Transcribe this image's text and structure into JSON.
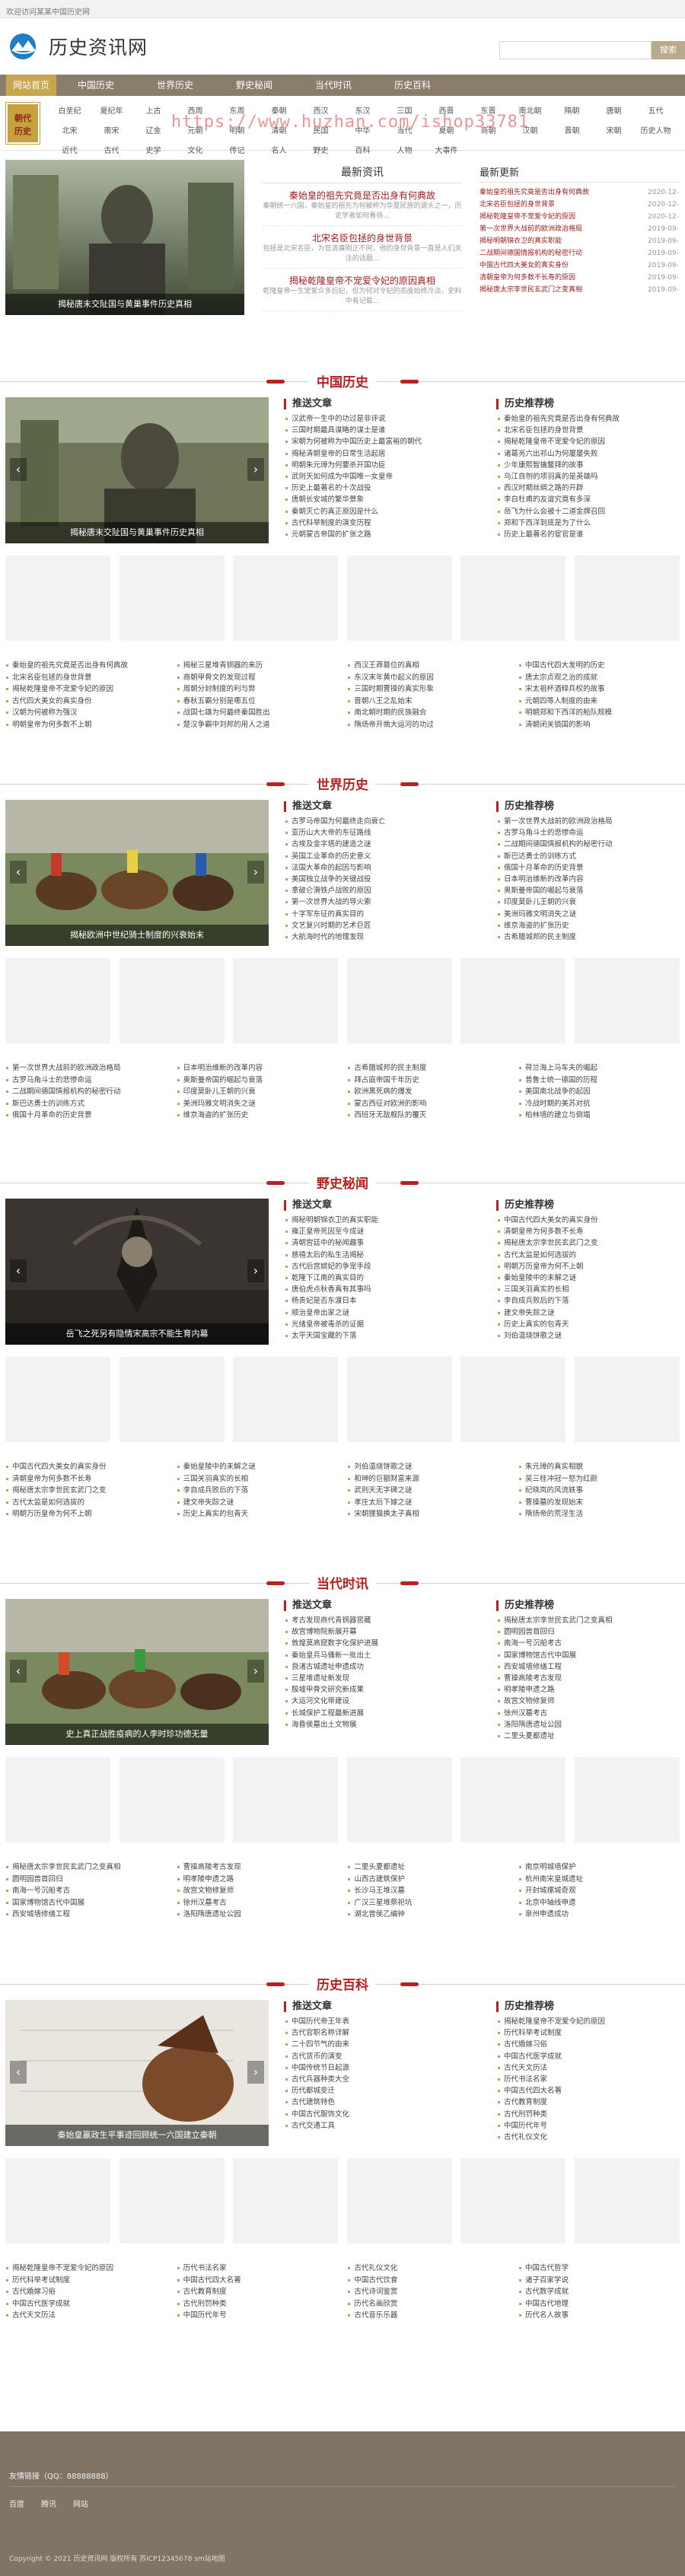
{
  "topbar": {
    "text": "欢迎访问某某中国历史网"
  },
  "header": {
    "site_name": "历史资讯网",
    "search_btn": "搜索"
  },
  "nav": {
    "items": [
      "网站首页",
      "中国历史",
      "世界历史",
      "野史秘闻",
      "当代时讯",
      "历史百科"
    ]
  },
  "catbar": {
    "badge": "朝代\n历史",
    "items": [
      "白垩纪",
      "夏纪年",
      "上古",
      "西周",
      "东周",
      "秦朝",
      "西汉",
      "东汉",
      "三国",
      "西晋",
      "东晋",
      "南北朝",
      "隋朝",
      "唐朝",
      "五代",
      "北宋",
      "南宋",
      "辽金",
      "元朝",
      "明朝",
      "清朝",
      "民国",
      "中华",
      "当代",
      "夏朝",
      "商朝",
      "汉朝",
      "晋朝",
      "宋朝",
      "历史人物",
      "近代",
      "古代",
      "史学",
      "文化",
      "传记",
      "名人",
      "野史",
      "百科",
      "人物",
      "大事件"
    ]
  },
  "watermark": "https://www.huzhan.com/ishop33781",
  "hero": {
    "caption": "揭秘唐末交阯国与黄巢事件历史真相",
    "mid_title": "最新资讯",
    "mid_items": [
      {
        "title": "秦始皇的祖先究竟是否出身有何典故",
        "desc": "秦朝统一六国，秦始皇的祖先为何被称为华夏民族的源头之一，历史学者如何看待..."
      },
      {
        "title": "北宋名臣包拯的身世背景",
        "desc": "包拯是北宋名臣，为官清廉刚正不阿，他的身世背景一直是人们关注的话题..."
      },
      {
        "title": "揭秘乾隆皇帝不宠爱令妃的原因真相",
        "desc": "乾隆皇帝一生宠爱众多后妃，但为何对令妃的态度始终冷淡，史料中有记载..."
      }
    ],
    "right_title": "最新更新",
    "right_items": [
      {
        "t": "秦始皇的祖先究竟是否出身有何典故",
        "d": "2020-12-"
      },
      {
        "t": "北宋名臣包拯的身世背景",
        "d": "2020-12-"
      },
      {
        "t": "揭秘乾隆皇帝不宠爱令妃的原因",
        "d": "2020-12-"
      },
      {
        "t": "第一次世界大战前的欧洲政治格局",
        "d": "2019-09-"
      },
      {
        "t": "揭秘明朝锦衣卫的真实职能",
        "d": "2019-09-"
      },
      {
        "t": "二战期间德国情报机构的秘密行动",
        "d": "2019-09-"
      },
      {
        "t": "中国古代四大美女的真实身份",
        "d": "2019-09-"
      },
      {
        "t": "清朝皇帝为何多数不长寿的原因",
        "d": "2019-09-"
      },
      {
        "t": "揭秘唐太宗李世民玄武门之变真相",
        "d": "2019-09-"
      }
    ]
  },
  "sections": [
    {
      "head": "中国历史",
      "caption": "揭秘唐末交阯国与黄巢事件历史真相",
      "left_title": "推送文章",
      "right_title": "历史推荐榜",
      "left": [
        "汉武帝一生中的功过是非评说",
        "三国时期最具谋略的谋士是谁",
        "宋朝为何被称为中国历史上最富裕的朝代",
        "揭秘清朝皇帝的日常生活起居",
        "明朝朱元璋为何要杀开国功臣",
        "武则天如何成为中国唯一女皇帝",
        "历史上最著名的十次战役",
        "唐朝长安城的繁华景象",
        "秦朝灭亡的真正原因是什么",
        "古代科举制度的演变历程",
        "元朝蒙古帝国的扩张之路"
      ],
      "right": [
        "秦始皇的祖先究竟是否出身有何典故",
        "北宋名臣包拯的身世背景",
        "揭秘乾隆皇帝不宠爱令妃的原因",
        "诸葛亮六出祁山为何屡屡失败",
        "少年康熙智擒鳌拜的故事",
        "乌江自刎的项羽真的是英雄吗",
        "西汉时期丝绸之路的开辟",
        "李白杜甫的友谊究竟有多深",
        "岳飞为什么会被十二道金牌召回",
        "郑和下西洋到底是为了什么",
        "历史上最著名的宦官是谁"
      ],
      "cols": [
        [
          "秦始皇的祖先究竟是否出身有何典故",
          "北宋名臣包拯的身世背景",
          "揭秘乾隆皇帝不宠爱令妃的原因",
          "古代四大美女的真实身份",
          "汉朝为何被称为强汉",
          "明朝皇帝为何多数不上朝"
        ],
        [
          "揭秘三星堆青铜器的来历",
          "商朝甲骨文的发现过程",
          "周朝分封制度的利与弊",
          "春秋五霸分别是哪五位",
          "战国七雄为何最终秦国胜出",
          "楚汉争霸中刘邦的用人之道"
        ],
        [
          "西汉王莽篡位的真相",
          "东汉末年黄巾起义的原因",
          "三国时期曹操的真实形象",
          "晋朝八王之乱始末",
          "南北朝时期的民族融合",
          "隋炀帝开凿大运河的功过"
        ],
        [
          "中国古代四大发明的历史",
          "唐太宗贞观之治的成就",
          "宋太祖杯酒释兵权的故事",
          "元朝四等人制度的由来",
          "明朝郑和下西洋的船队规模",
          "清朝闭关锁国的影响"
        ]
      ]
    },
    {
      "head": "世界历史",
      "caption": "揭秘欧洲中世纪骑士制度的兴衰始末",
      "left_title": "推送文章",
      "right_title": "历史推荐榜",
      "left": [
        "古罗马帝国为何最终走向衰亡",
        "亚历山大大帝的东征路线",
        "古埃及金字塔的建造之谜",
        "英国工业革命的历史意义",
        "法国大革命的起因与影响",
        "美国独立战争的关键战役",
        "拿破仑滑铁卢战败的原因",
        "第一次世界大战的导火索",
        "十字军东征的真实目的",
        "文艺复兴时期的艺术巨匠",
        "大航海时代的地理发现"
      ],
      "right": [
        "第一次世界大战前的欧洲政治格局",
        "古罗马角斗士的悲惨命运",
        "二战期间德国情报机构的秘密行动",
        "斯巴达勇士的训练方式",
        "俄国十月革命的历史背景",
        "日本明治维新的改革内容",
        "奥斯曼帝国的崛起与衰落",
        "印度莫卧儿王朝的兴衰",
        "美洲玛雅文明消失之谜",
        "维京海盗的扩张历史",
        "古希腊城邦的民主制度"
      ],
      "cols": [
        [
          "第一次世界大战前的欧洲政治格局",
          "古罗马角斗士的悲惨命运",
          "二战期间德国情报机构的秘密行动",
          "斯巴达勇士的训练方式",
          "俄国十月革命的历史背景"
        ],
        [
          "日本明治维新的改革内容",
          "奥斯曼帝国的崛起与衰落",
          "印度莫卧儿王朝的兴衰",
          "美洲玛雅文明消失之谜",
          "维京海盗的扩张历史"
        ],
        [
          "古希腊城邦的民主制度",
          "拜占庭帝国千年历史",
          "欧洲黑死病的爆发",
          "蒙古西征对欧洲的影响",
          "西班牙无敌舰队的覆灭"
        ],
        [
          "荷兰海上马车夫的崛起",
          "普鲁士统一德国的历程",
          "美国南北战争的起因",
          "冷战时期的美苏对抗",
          "柏林墙的建立与倒塌"
        ]
      ]
    },
    {
      "head": "野史秘闻",
      "caption": "岳飞之死另有隐情宋高宗不能生育内幕",
      "left_title": "推送文章",
      "right_title": "历史推荐榜",
      "left": [
        "揭秘明朝锦衣卫的真实职能",
        "雍正皇帝死因至今成谜",
        "清朝宫廷中的秘闻趣事",
        "慈禧太后的私生活揭秘",
        "古代后宫嫔妃的争宠手段",
        "乾隆下江南的真实目的",
        "唐伯虎点秋香真有其事吗",
        "杨贵妃是否东渡日本",
        "顺治皇帝出家之谜",
        "光绪皇帝被毒杀的证据",
        "太平天国宝藏的下落"
      ],
      "right": [
        "中国古代四大美女的真实身份",
        "清朝皇帝为何多数不长寿",
        "揭秘唐太宗李世民玄武门之变",
        "古代太监是如何选拔的",
        "明朝万历皇帝为何不上朝",
        "秦始皇陵中的未解之谜",
        "三国关羽真实的长相",
        "李自成兵败后的下落",
        "建文帝失踪之谜",
        "历史上真实的包青天",
        "刘伯温烧饼歌之谜"
      ],
      "cols": [
        [
          "中国古代四大美女的真实身份",
          "清朝皇帝为何多数不长寿",
          "揭秘唐太宗李世民玄武门之变",
          "古代太监是如何选拔的",
          "明朝万历皇帝为何不上朝"
        ],
        [
          "秦始皇陵中的未解之谜",
          "三国关羽真实的长相",
          "李自成兵败后的下落",
          "建文帝失踪之谜",
          "历史上真实的包青天"
        ],
        [
          "刘伯温烧饼歌之谜",
          "和珅的巨额财富来源",
          "武则天无字碑之谜",
          "孝庄太后下嫁之谜",
          "宋朝狸猫换太子真相"
        ],
        [
          "朱元璋的真实相貌",
          "吴三桂冲冠一怒为红颜",
          "纪晓岚的风流轶事",
          "曹操墓的发现始末",
          "隋炀帝的荒淫生活"
        ]
      ]
    },
    {
      "head": "当代时讯",
      "caption": "史上真正战胜疫病的人李时珍功德无量",
      "left_title": "推送文章",
      "right_title": "历史推荐榜",
      "left": [
        "考古发现商代青铜器窖藏",
        "故宫博物院新展开幕",
        "敦煌莫高窟数字化保护进展",
        "秦始皇兵马俑新一批出土",
        "良渚古城遗址申遗成功",
        "三星堆遗址新发现",
        "殷墟甲骨文研究新成果",
        "大运河文化带建设",
        "长城保护工程最新进展",
        "海昏侯墓出土文物展"
      ],
      "right": [
        "揭秘唐太宗李世民玄武门之变真相",
        "圆明园兽首回归",
        "南海一号沉船考古",
        "国家博物馆古代中国展",
        "西安城墙修缮工程",
        "曹操高陵考古发现",
        "明孝陵申遗之路",
        "故宫文物修复师",
        "徐州汉墓考古",
        "洛阳隋唐遗址公园",
        "二里头夏都遗址"
      ],
      "cols": [
        [
          "揭秘唐太宗李世民玄武门之变真相",
          "圆明园兽首回归",
          "南海一号沉船考古",
          "国家博物馆古代中国展",
          "西安城墙修缮工程"
        ],
        [
          "曹操高陵考古发现",
          "明孝陵申遗之路",
          "故宫文物修复师",
          "徐州汉墓考古",
          "洛阳隋唐遗址公园"
        ],
        [
          "二里头夏都遗址",
          "山西古建筑保护",
          "长沙马王堆汉墓",
          "广汉三星堆祭祀坑",
          "湖北曾侯乙编钟"
        ],
        [
          "南京明城墙保护",
          "杭州南宋皇城遗址",
          "开封城摞城奇观",
          "北京中轴线申遗",
          "泉州申遗成功"
        ]
      ]
    },
    {
      "head": "历史百科",
      "caption": "秦始皇嬴政生平事迹回顾统一六国建立秦朝",
      "left_title": "推送文章",
      "right_title": "历史推荐榜",
      "left": [
        "中国历代帝王年表",
        "古代官职名称详解",
        "二十四节气的由来",
        "古代货币的演变",
        "中国传统节日起源",
        "古代兵器种类大全",
        "历代都城变迁",
        "古代建筑特色",
        "中国古代服饰文化",
        "古代交通工具"
      ],
      "right": [
        "揭秘乾隆皇帝不宠爱令妃的原因",
        "历代科举考试制度",
        "古代婚嫁习俗",
        "中国古代医学成就",
        "古代天文历法",
        "历代书法名家",
        "中国古代四大名著",
        "古代教育制度",
        "古代刑罚种类",
        "中国历代年号",
        "古代礼仪文化"
      ],
      "cols": [
        [
          "揭秘乾隆皇帝不宠爱令妃的原因",
          "历代科举考试制度",
          "古代婚嫁习俗",
          "中国古代医学成就",
          "古代天文历法"
        ],
        [
          "历代书法名家",
          "中国古代四大名著",
          "古代教育制度",
          "古代刑罚种类",
          "中国历代年号"
        ],
        [
          "古代礼仪文化",
          "中国古代饮食",
          "古代诗词鉴赏",
          "历代名画欣赏",
          "古代音乐乐器"
        ],
        [
          "中国古代哲学",
          "诸子百家学说",
          "古代数学成就",
          "中国古代地理",
          "历代名人故事"
        ]
      ]
    }
  ],
  "footer": {
    "friend": "友情链接（QQ：88888888）",
    "links": [
      "百度",
      "腾讯",
      "网站"
    ],
    "copyright": "Copyright © 2021 历史资讯网 版权所有  苏ICP12345678  sm站地图"
  }
}
